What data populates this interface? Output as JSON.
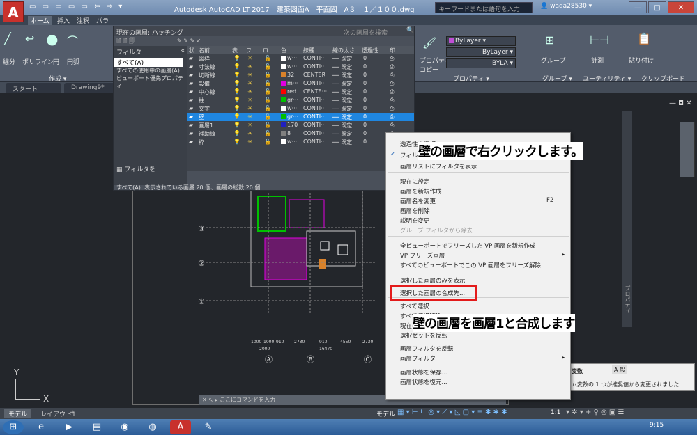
{
  "app": {
    "logo": "A",
    "logo_sub": "LT",
    "title": "Autodesk AutoCAD LT 2017　建築図面A　平面図　A３　１／１００.dwg",
    "search_placeholder": "キーワードまたは語句を入力",
    "user": "wada28530",
    "controls": {
      "min": "—",
      "max": "□",
      "close": "✕"
    }
  },
  "ribbon": {
    "tabs": [
      "ホーム",
      "挿入",
      "注釈",
      "パラ"
    ],
    "draw_tools": [
      "線分",
      "ポリライン",
      "円",
      "円弧"
    ],
    "panel_create": "作成 ▾",
    "panel_properties": "プロパティ ▾",
    "panel_group": "グループ ▾",
    "panel_utility": "ユーティリティ ▾",
    "panel_clipboard": "クリップボード",
    "props_label": "プロパティ\nコピー",
    "bylayer_color": "ByLayer",
    "bylayer_line": "ByLayer",
    "bylayer_short": "BYLA",
    "group_label": "グループ",
    "measure_label": "計測",
    "paste_label": "貼り付け"
  },
  "doc_tabs": [
    "スタート",
    "Drawing9*"
  ],
  "layer_panel": {
    "current": "現在の画層: ハッチング",
    "search_placeholder": "次の画層を検索",
    "filter_label": "フィルタ",
    "filter_collapse": "«",
    "filters": [
      "すべて(A)",
      "すべての使用中の画層(A)",
      "ビューポート優先プロパティ"
    ],
    "invert_filter": "フィルタを",
    "footer": "すべて(A): 表示されている画層 20 個、画層の総数 20 個",
    "columns": [
      "状.",
      "名前",
      "表.",
      "フ...",
      "ロ...",
      "色",
      "線種",
      "線の太さ",
      "透過性",
      "印"
    ],
    "rows": [
      {
        "name": "図枠",
        "color_name": "w···",
        "color": "#ffffff",
        "linetype": "CONTI···",
        "weight": "既定",
        "trans": "0"
      },
      {
        "name": "寸法線",
        "color_name": "w···",
        "color": "#ffffff",
        "linetype": "CONTI···",
        "weight": "既定",
        "trans": "0"
      },
      {
        "name": "切断線",
        "color_name": "32",
        "color": "#d9822b",
        "linetype": "CENTER",
        "weight": "既定",
        "trans": "0"
      },
      {
        "name": "設備",
        "color_name": "m···",
        "color": "#e000e0",
        "linetype": "CONTI···",
        "weight": "既定",
        "trans": "0"
      },
      {
        "name": "中心線",
        "color_name": "red",
        "color": "#ff0000",
        "linetype": "CENTE···",
        "weight": "既定",
        "trans": "0"
      },
      {
        "name": "柱",
        "color_name": "gr···",
        "color": "#00c000",
        "linetype": "CONTI···",
        "weight": "既定",
        "trans": "0"
      },
      {
        "name": "文字",
        "color_name": "w···",
        "color": "#ffffff",
        "linetype": "CONTI···",
        "weight": "既定",
        "trans": "0"
      },
      {
        "name": "壁",
        "color_name": "gr···",
        "color": "#00c000",
        "linetype": "CONTI···",
        "weight": "既定",
        "trans": "0",
        "selected": true
      },
      {
        "name": "画層1",
        "color_name": "170",
        "color": "#2020c0",
        "linetype": "CONTI···",
        "weight": "既定",
        "trans": "0"
      },
      {
        "name": "補助線",
        "color_name": "8",
        "color": "#808080",
        "linetype": "CONTI···",
        "weight": "既定",
        "trans": "0"
      },
      {
        "name": "枠",
        "color_name": "w···",
        "color": "#ffffff",
        "linetype": "CONTI···",
        "weight": "既定",
        "trans": "0"
      }
    ]
  },
  "context_menu": {
    "items": [
      {
        "label": "透過性を選択",
        "y": 0
      },
      {
        "label": "フィルタ ツリーを表示",
        "y": 1,
        "checked": true
      },
      {
        "label": "画層リストにフィルタを表示",
        "y": 2
      },
      {
        "label": "現在に設定",
        "y": 3
      },
      {
        "label": "画層を新規作成",
        "y": 4
      },
      {
        "label": "画層名を変更",
        "y": 5,
        "shortcut": "F2"
      },
      {
        "label": "画層を削除",
        "y": 6
      },
      {
        "label": "説明を変更",
        "y": 7
      },
      {
        "label": "グループ フィルタから除去",
        "y": 8,
        "disabled": true
      },
      {
        "label": "全ビューポートでフリーズした VP 画層を新規作成",
        "y": 9
      },
      {
        "label": "VP フリーズ画層",
        "y": 10,
        "submenu": true
      },
      {
        "label": "すべてのビューポートでこの VP 画層をフリーズ解除",
        "y": 11
      },
      {
        "label": "選択した画層のみを表示",
        "y": 12
      },
      {
        "label": "選択した画層の合成先...",
        "y": 13,
        "highlight": true
      },
      {
        "label": "すべて選択",
        "y": 14
      },
      {
        "label": "すべて選択解除",
        "y": 15
      },
      {
        "label": "現在の画層以外を選択",
        "y": 16
      },
      {
        "label": "選択セットを反転",
        "y": 17
      },
      {
        "label": "画層フィルタを反転",
        "y": 18
      },
      {
        "label": "画層フィルタ",
        "y": 19,
        "submenu": true
      },
      {
        "label": "画層状態を保存...",
        "y": 20
      },
      {
        "label": "画層状態を復元...",
        "y": 21
      }
    ]
  },
  "callouts": {
    "first": "壁の画層で右クリックします。",
    "second": "壁の画層を画層1と合成します"
  },
  "drawing": {
    "axis_labels_left": [
      "③",
      "②",
      "①"
    ],
    "axis_labels_bottom": [
      "Ⓐ",
      "Ⓑ",
      "Ⓒ"
    ],
    "dims": [
      "1000",
      "1000",
      "910",
      "2730",
      "910",
      "4550",
      "2730",
      "16470",
      "2000"
    ]
  },
  "command_line": "ここにコマンドを入力",
  "layout_tabs": [
    "モデル",
    "レイアウト1",
    "+"
  ],
  "status_model": "モデル",
  "status_scale": "1:1",
  "notification": {
    "title": "変数",
    "text": "ム変数の 1 つが推奨値から変更されました",
    "ime": "A 般"
  },
  "palette_label": "プロパティ",
  "clock": "9:15",
  "ucs_x": "X",
  "ucs_y": "Y"
}
